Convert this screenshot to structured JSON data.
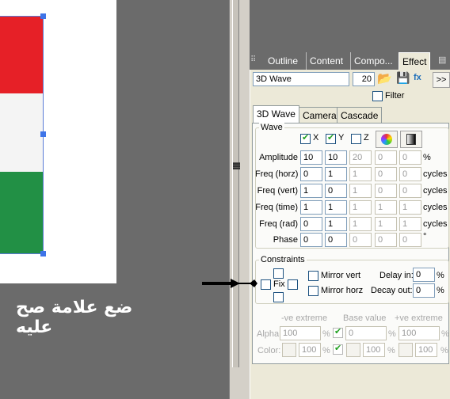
{
  "annotation_text": "ضع علامة صح عليه",
  "canvas": {
    "flag_colors": [
      "#e62027",
      "#f4f4f4",
      "#229045"
    ]
  },
  "panel_tabs": [
    {
      "label": "Outline"
    },
    {
      "label": "Content"
    },
    {
      "label": "Compo..."
    },
    {
      "label": "Effect"
    }
  ],
  "effect_bar": {
    "name_value": "3D Wave",
    "number_value": "20",
    "more_label": ">>",
    "filter_label": "Filter"
  },
  "sub_tabs": [
    "3D Wave",
    "Camera",
    "Cascade"
  ],
  "wave": {
    "title": "Wave",
    "axes": {
      "x": "X",
      "y": "Y",
      "z": "Z"
    },
    "rows": [
      {
        "label": "Amplitude",
        "values": [
          "10",
          "10",
          "20",
          "0",
          "0"
        ],
        "unit": "%"
      },
      {
        "label": "Freq (horz)",
        "values": [
          "0",
          "1",
          "1",
          "0",
          "0"
        ],
        "unit": "cycles"
      },
      {
        "label": "Freq (vert)",
        "values": [
          "1",
          "0",
          "1",
          "0",
          "0"
        ],
        "unit": "cycles"
      },
      {
        "label": "Freq (time)",
        "values": [
          "1",
          "1",
          "1",
          "1",
          "1"
        ],
        "unit": "cycles"
      },
      {
        "label": "Freq (rad)",
        "values": [
          "0",
          "1",
          "1",
          "1",
          "1"
        ],
        "unit": "cycles"
      },
      {
        "label": "Phase",
        "values": [
          "0",
          "0",
          "0",
          "0",
          "0"
        ],
        "unit": "°"
      }
    ]
  },
  "constraints": {
    "title": "Constraints",
    "fix_label": "Fix",
    "mirror_vert": "Mirror vert",
    "mirror_horz": "Mirror horz",
    "delay_label": "Delay in:",
    "delay_value": "0",
    "decay_label": "Decay out:",
    "decay_value": "0",
    "pct": "%"
  },
  "extremes": {
    "neg_header": "-ve extreme",
    "base_header": "Base value",
    "pos_header": "+ve extreme",
    "alpha_label": "Alpha:",
    "alpha": [
      "100",
      "0",
      "100"
    ],
    "color_label": "Color:",
    "color": [
      "100",
      "100",
      "100"
    ],
    "pct": "%"
  }
}
